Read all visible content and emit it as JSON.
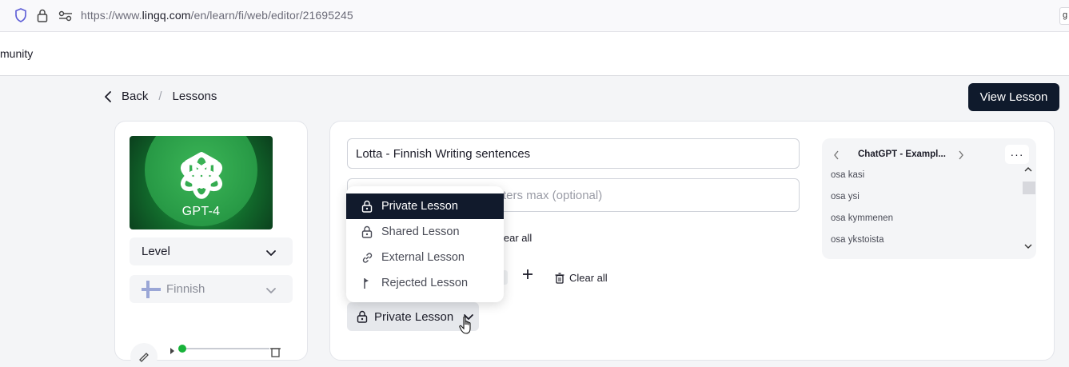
{
  "browser": {
    "url_prefix": "https://www.",
    "url_domain": "lingq.com",
    "url_path": "/en/learn/fi/web/editor/21695245",
    "edge_text": "g"
  },
  "topnav": {
    "community_label": "munity"
  },
  "subbar": {
    "back_label": "Back",
    "separator": "/",
    "lessons_label": "Lessons",
    "view_lesson_label": "View Lesson"
  },
  "left": {
    "thumb_text": "GPT-4",
    "level_label": "Level",
    "language_label": "Finnish"
  },
  "main": {
    "title_value": "Lotta - Finnish Writing sentences",
    "description_placeholder": "ters max (optional)",
    "tags_clear_label": "lear all",
    "clear_all_label": "Clear all",
    "privacy_label": "Private Lesson"
  },
  "dropdown": {
    "items": [
      {
        "label": "Private Lesson",
        "icon": "lock-icon",
        "active": true
      },
      {
        "label": "Shared Lesson",
        "icon": "lock-open-icon",
        "active": false
      },
      {
        "label": "External Lesson",
        "icon": "link-icon",
        "active": false
      },
      {
        "label": "Rejected Lesson",
        "icon": "flag-icon",
        "active": false
      }
    ]
  },
  "collection": {
    "title": "ChatGPT - Exampl...",
    "more_label": "···",
    "items": [
      "osa kasi",
      "osa ysi",
      "osa kymmenen",
      "osa ykstoista"
    ]
  },
  "colors": {
    "primary_dark": "#0f1a2c",
    "accent_green": "#18b23a"
  }
}
